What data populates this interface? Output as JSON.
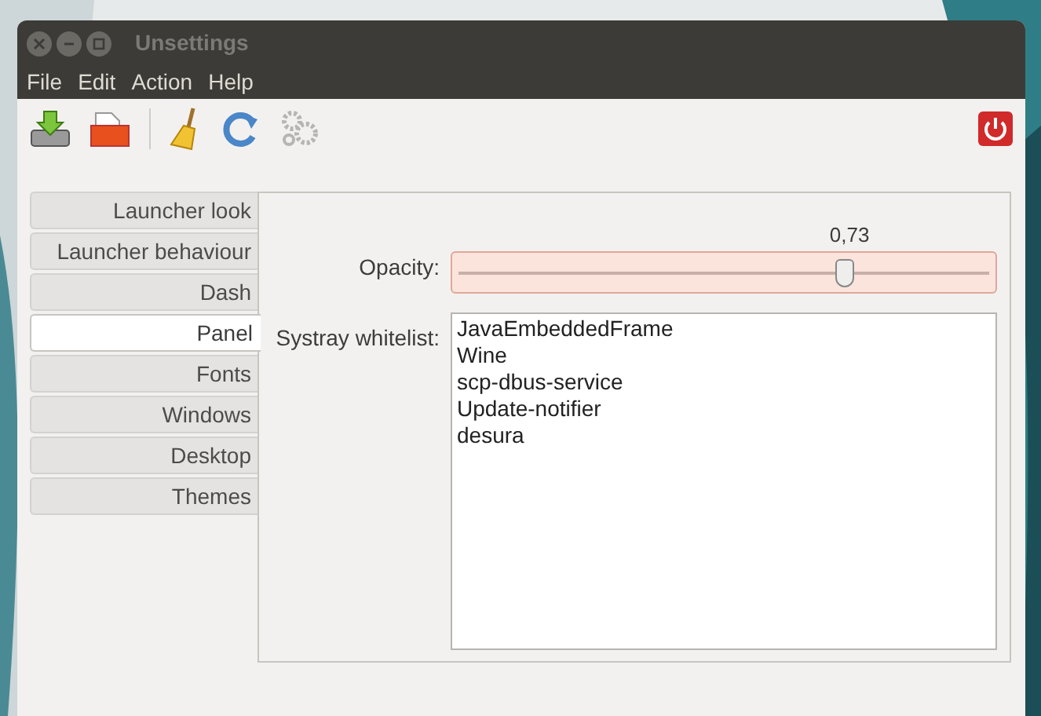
{
  "window": {
    "title": "Unsettings"
  },
  "menu": [
    "File",
    "Edit",
    "Action",
    "Help"
  ],
  "tabs": [
    {
      "label": "Launcher look",
      "selected": false
    },
    {
      "label": "Launcher behaviour",
      "selected": false
    },
    {
      "label": "Dash",
      "selected": false
    },
    {
      "label": "Panel",
      "selected": true
    },
    {
      "label": "Fonts",
      "selected": false
    },
    {
      "label": "Windows",
      "selected": false
    },
    {
      "label": "Desktop",
      "selected": false
    },
    {
      "label": "Themes",
      "selected": false
    }
  ],
  "opacity": {
    "label": "Opacity:",
    "value": "0,73",
    "level": 0.73
  },
  "systray": {
    "label": "Systray whitelist:",
    "items": [
      "JavaEmbeddedFrame",
      "Wine",
      "scp-dbus-service",
      "Update-notifier",
      "desura"
    ]
  }
}
